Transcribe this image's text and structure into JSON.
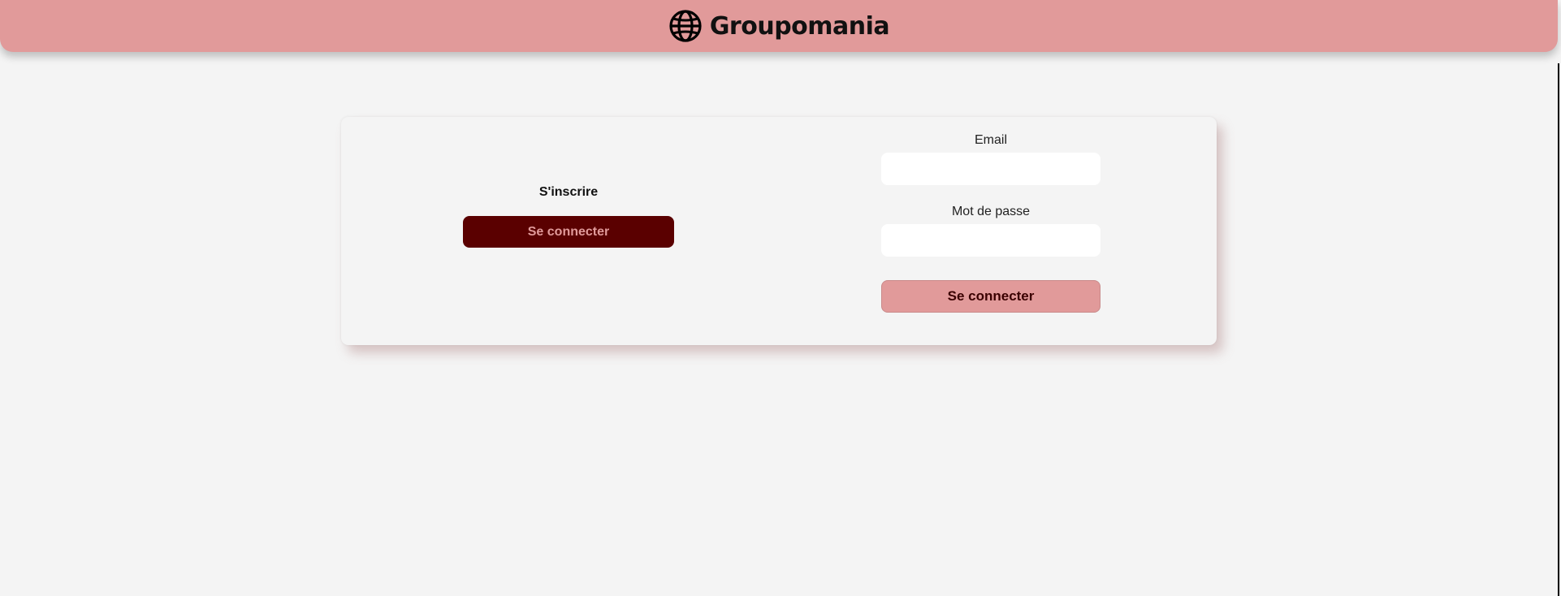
{
  "header": {
    "brand_name": "Groupomania",
    "logo_icon": "globe-icon",
    "background_color": "#e19a9a"
  },
  "signup": {
    "label": "S'inscrire",
    "button_label": "Se connecter",
    "button_color": "#5a0000"
  },
  "login_form": {
    "email_label": "Email",
    "email_value": "",
    "password_label": "Mot de passe",
    "password_value": "",
    "submit_label": "Se connecter",
    "submit_color": "#e19a9a"
  }
}
